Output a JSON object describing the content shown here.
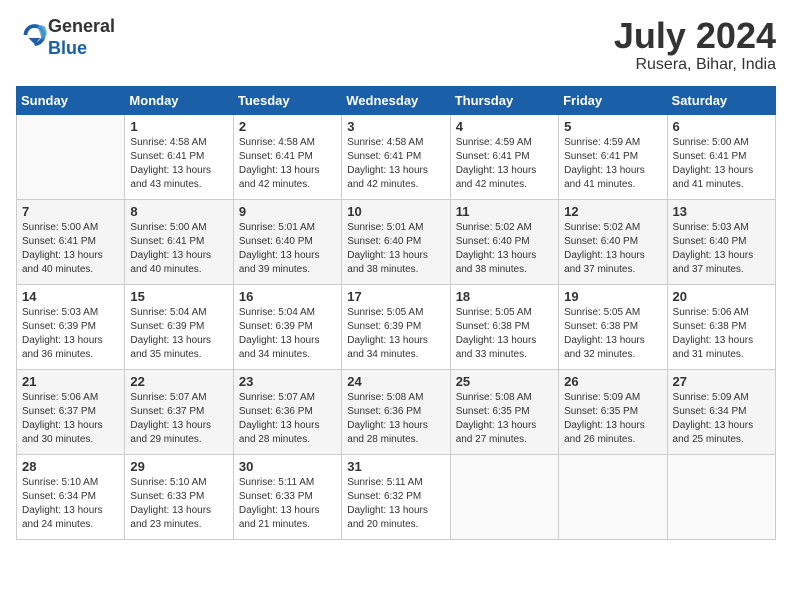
{
  "header": {
    "logo_line1": "General",
    "logo_line2": "Blue",
    "month": "July 2024",
    "location": "Rusera, Bihar, India"
  },
  "days_of_week": [
    "Sunday",
    "Monday",
    "Tuesday",
    "Wednesday",
    "Thursday",
    "Friday",
    "Saturday"
  ],
  "weeks": [
    [
      {
        "day": "",
        "info": ""
      },
      {
        "day": "1",
        "info": "Sunrise: 4:58 AM\nSunset: 6:41 PM\nDaylight: 13 hours\nand 43 minutes."
      },
      {
        "day": "2",
        "info": "Sunrise: 4:58 AM\nSunset: 6:41 PM\nDaylight: 13 hours\nand 42 minutes."
      },
      {
        "day": "3",
        "info": "Sunrise: 4:58 AM\nSunset: 6:41 PM\nDaylight: 13 hours\nand 42 minutes."
      },
      {
        "day": "4",
        "info": "Sunrise: 4:59 AM\nSunset: 6:41 PM\nDaylight: 13 hours\nand 42 minutes."
      },
      {
        "day": "5",
        "info": "Sunrise: 4:59 AM\nSunset: 6:41 PM\nDaylight: 13 hours\nand 41 minutes."
      },
      {
        "day": "6",
        "info": "Sunrise: 5:00 AM\nSunset: 6:41 PM\nDaylight: 13 hours\nand 41 minutes."
      }
    ],
    [
      {
        "day": "7",
        "info": "Sunrise: 5:00 AM\nSunset: 6:41 PM\nDaylight: 13 hours\nand 40 minutes."
      },
      {
        "day": "8",
        "info": "Sunrise: 5:00 AM\nSunset: 6:41 PM\nDaylight: 13 hours\nand 40 minutes."
      },
      {
        "day": "9",
        "info": "Sunrise: 5:01 AM\nSunset: 6:40 PM\nDaylight: 13 hours\nand 39 minutes."
      },
      {
        "day": "10",
        "info": "Sunrise: 5:01 AM\nSunset: 6:40 PM\nDaylight: 13 hours\nand 38 minutes."
      },
      {
        "day": "11",
        "info": "Sunrise: 5:02 AM\nSunset: 6:40 PM\nDaylight: 13 hours\nand 38 minutes."
      },
      {
        "day": "12",
        "info": "Sunrise: 5:02 AM\nSunset: 6:40 PM\nDaylight: 13 hours\nand 37 minutes."
      },
      {
        "day": "13",
        "info": "Sunrise: 5:03 AM\nSunset: 6:40 PM\nDaylight: 13 hours\nand 37 minutes."
      }
    ],
    [
      {
        "day": "14",
        "info": "Sunrise: 5:03 AM\nSunset: 6:39 PM\nDaylight: 13 hours\nand 36 minutes."
      },
      {
        "day": "15",
        "info": "Sunrise: 5:04 AM\nSunset: 6:39 PM\nDaylight: 13 hours\nand 35 minutes."
      },
      {
        "day": "16",
        "info": "Sunrise: 5:04 AM\nSunset: 6:39 PM\nDaylight: 13 hours\nand 34 minutes."
      },
      {
        "day": "17",
        "info": "Sunrise: 5:05 AM\nSunset: 6:39 PM\nDaylight: 13 hours\nand 34 minutes."
      },
      {
        "day": "18",
        "info": "Sunrise: 5:05 AM\nSunset: 6:38 PM\nDaylight: 13 hours\nand 33 minutes."
      },
      {
        "day": "19",
        "info": "Sunrise: 5:05 AM\nSunset: 6:38 PM\nDaylight: 13 hours\nand 32 minutes."
      },
      {
        "day": "20",
        "info": "Sunrise: 5:06 AM\nSunset: 6:38 PM\nDaylight: 13 hours\nand 31 minutes."
      }
    ],
    [
      {
        "day": "21",
        "info": "Sunrise: 5:06 AM\nSunset: 6:37 PM\nDaylight: 13 hours\nand 30 minutes."
      },
      {
        "day": "22",
        "info": "Sunrise: 5:07 AM\nSunset: 6:37 PM\nDaylight: 13 hours\nand 29 minutes."
      },
      {
        "day": "23",
        "info": "Sunrise: 5:07 AM\nSunset: 6:36 PM\nDaylight: 13 hours\nand 28 minutes."
      },
      {
        "day": "24",
        "info": "Sunrise: 5:08 AM\nSunset: 6:36 PM\nDaylight: 13 hours\nand 28 minutes."
      },
      {
        "day": "25",
        "info": "Sunrise: 5:08 AM\nSunset: 6:35 PM\nDaylight: 13 hours\nand 27 minutes."
      },
      {
        "day": "26",
        "info": "Sunrise: 5:09 AM\nSunset: 6:35 PM\nDaylight: 13 hours\nand 26 minutes."
      },
      {
        "day": "27",
        "info": "Sunrise: 5:09 AM\nSunset: 6:34 PM\nDaylight: 13 hours\nand 25 minutes."
      }
    ],
    [
      {
        "day": "28",
        "info": "Sunrise: 5:10 AM\nSunset: 6:34 PM\nDaylight: 13 hours\nand 24 minutes."
      },
      {
        "day": "29",
        "info": "Sunrise: 5:10 AM\nSunset: 6:33 PM\nDaylight: 13 hours\nand 23 minutes."
      },
      {
        "day": "30",
        "info": "Sunrise: 5:11 AM\nSunset: 6:33 PM\nDaylight: 13 hours\nand 21 minutes."
      },
      {
        "day": "31",
        "info": "Sunrise: 5:11 AM\nSunset: 6:32 PM\nDaylight: 13 hours\nand 20 minutes."
      },
      {
        "day": "",
        "info": ""
      },
      {
        "day": "",
        "info": ""
      },
      {
        "day": "",
        "info": ""
      }
    ]
  ]
}
